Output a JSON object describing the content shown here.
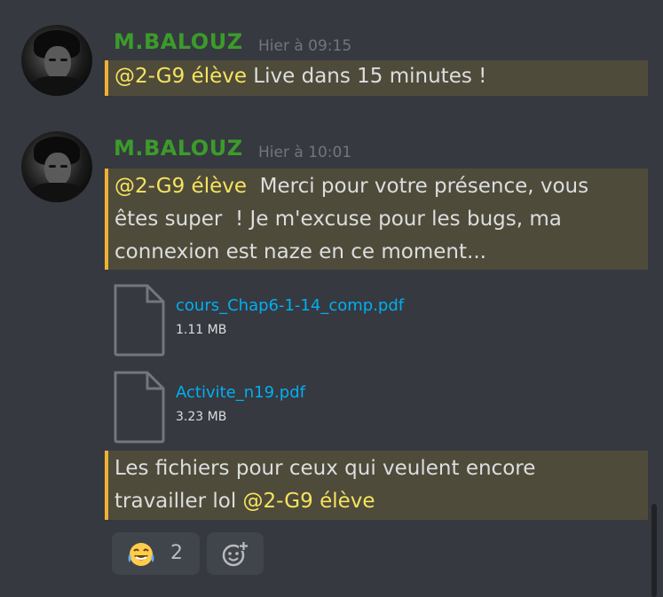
{
  "messages": [
    {
      "author": "M.BALOUZ",
      "timestamp": "Hier à 09:15",
      "mention": "@2-G9 élève",
      "text": " Live dans 15 minutes !"
    },
    {
      "author": "M.BALOUZ",
      "timestamp": "Hier à 10:01",
      "mention": "@2-G9 élève",
      "line1": "  Merci pour votre présence, vous",
      "line2": "êtes super  ! Je m'excuse pour les bugs, ma",
      "line3": "connexion est naze en ce moment..."
    }
  ],
  "attachments": [
    {
      "name": "cours_Chap6-1-14_comp.pdf",
      "size": "1.11 MB",
      "icon": "file-icon"
    },
    {
      "name": "Activite_n19.pdf",
      "size": "3.23 MB",
      "icon": "file-icon"
    }
  ],
  "followup": {
    "line1": "Les fichiers pour ceux qui veulent encore",
    "line2_text": "travailler lol ",
    "mention": "@2-G9 élève"
  },
  "reactions": [
    {
      "emoji": "joy-tears-emoji",
      "count": "2"
    }
  ],
  "add_reaction_icon": "add-reaction-icon",
  "colors": {
    "background": "#36393f",
    "author": "#3c9b2b",
    "mention_text": "#f6e45e",
    "mention_bg": "#4f4b3b",
    "mention_border": "#f0b232",
    "link": "#00aff4"
  }
}
